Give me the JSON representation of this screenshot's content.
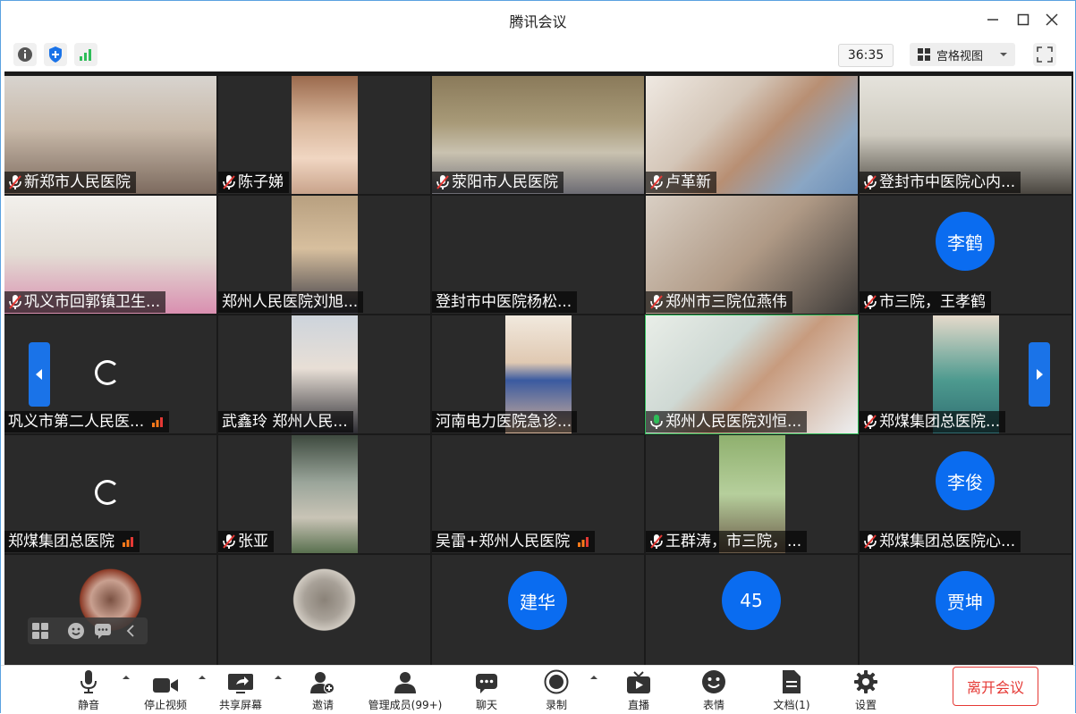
{
  "window": {
    "title": "腾讯会议"
  },
  "infobar": {
    "timer": "36:35",
    "view_mode": "宫格视图"
  },
  "tiles": [
    {
      "name": "新郑市人民医院",
      "mic": "muted"
    },
    {
      "name": "陈子娣",
      "mic": "muted"
    },
    {
      "name": "荥阳市人民医院",
      "mic": "muted"
    },
    {
      "name": "卢革新",
      "mic": "muted"
    },
    {
      "name": "登封市中医院心内...",
      "mic": "muted"
    },
    {
      "name": "巩义市回郭镇卫生...",
      "mic": "muted"
    },
    {
      "name": "郑州人民医院刘旭...",
      "mic": "none"
    },
    {
      "name": "登封市中医院杨松...",
      "mic": "none"
    },
    {
      "name": "郑州市三院位燕伟",
      "mic": "muted"
    },
    {
      "name": "市三院，王孝鹤",
      "mic": "muted",
      "avatar": "李鹤"
    },
    {
      "name": "巩义市第二人民医...",
      "mic": "none",
      "loading": true,
      "signal": true
    },
    {
      "name": "武鑫玲 郑州人民...",
      "mic": "none"
    },
    {
      "name": "河南电力医院急诊...",
      "mic": "none"
    },
    {
      "name": "郑州人民医院刘恒...",
      "mic": "active"
    },
    {
      "name": "郑煤集团总医院...",
      "mic": "muted"
    },
    {
      "name": "郑煤集团总医院",
      "mic": "none",
      "loading": true,
      "signal": true
    },
    {
      "name": "张亚",
      "mic": "muted"
    },
    {
      "name": "吴雷+郑州人民医院",
      "mic": "none",
      "signal": true
    },
    {
      "name": "王群涛，市三院，...",
      "mic": "muted"
    },
    {
      "name": "郑煤集团总医院心...",
      "mic": "muted",
      "avatar": "李俊"
    },
    {
      "name": "",
      "mic": "none"
    },
    {
      "name": "",
      "mic": "none"
    },
    {
      "name": "",
      "mic": "none",
      "avatar": "建华"
    },
    {
      "name": "",
      "mic": "none",
      "avatar": "45"
    },
    {
      "name": "",
      "mic": "none",
      "avatar": "贾坤"
    }
  ],
  "toolbar": {
    "mute": "静音",
    "stop_video": "停止视频",
    "share_screen": "共享屏幕",
    "invite": "邀请",
    "manage_members": "管理成员(99+)",
    "chat": "聊天",
    "record": "录制",
    "live": "直播",
    "reactions": "表情",
    "docs": "文档(1)",
    "settings": "设置",
    "leave": "离开会议"
  },
  "colors": {
    "accent": "#0a6cf0",
    "leave": "#e53935",
    "signal": "#2ebd59"
  }
}
